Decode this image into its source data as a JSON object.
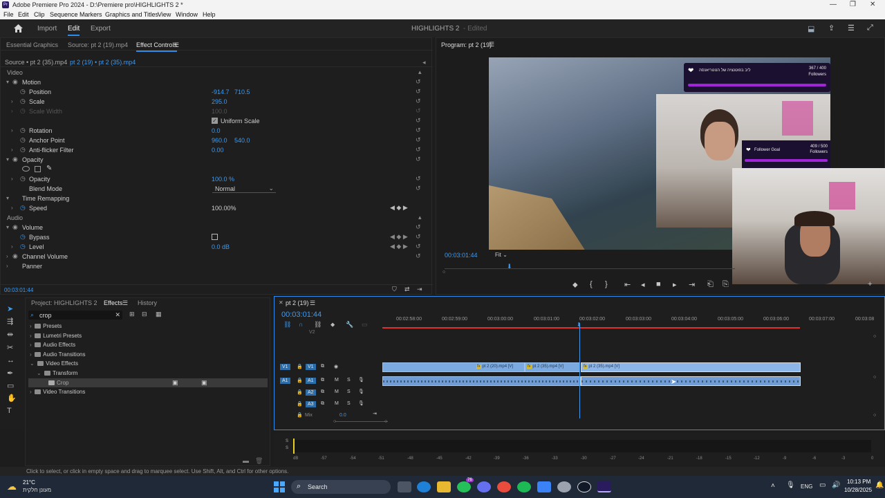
{
  "window": {
    "title": "Adobe Premiere Pro 2024 - D:\\Premiere pro\\HIGHLIGHTS 2 *",
    "logo": "Pr"
  },
  "menu": [
    "File",
    "Edit",
    "Clip",
    "Sequence",
    "Markers",
    "Graphics and Titles",
    "View",
    "Window",
    "Help"
  ],
  "header": {
    "tabs": [
      "Import",
      "Edit",
      "Export"
    ],
    "active_tab": "Edit",
    "project_title": "HIGHLIGHTS 2",
    "edited": "- Edited"
  },
  "source_panel": {
    "tabs": [
      "Essential Graphics",
      "Source: pt 2 (19).mp4",
      "Effect Controls"
    ],
    "active_tab": "Effect Controls",
    "clip_source": "Source • pt 2 (35).mp4",
    "clip_seq": "pt 2 (19) • pt 2 (35).mp4",
    "rows": {
      "video": "Video",
      "motion": "Motion",
      "position": "Position",
      "position_x": "-914.7",
      "position_y": "710.5",
      "scale": "Scale",
      "scale_v": "295.0",
      "scale_width": "Scale Width",
      "scale_width_v": "100.0",
      "uniform_scale": "Uniform Scale",
      "rotation": "Rotation",
      "rotation_v": "0.0",
      "anchor": "Anchor Point",
      "anchor_x": "960.0",
      "anchor_y": "540.0",
      "flicker": "Anti-flicker Filter",
      "flicker_v": "0.00",
      "opacity_sec": "Opacity",
      "opacity": "Opacity",
      "opacity_v": "100.0 %",
      "blend": "Blend Mode",
      "blend_v": "Normal",
      "time_remap": "Time Remapping",
      "speed": "Speed",
      "speed_v": "100.00%",
      "audio": "Audio",
      "volume": "Volume",
      "bypass": "Bypass",
      "level": "Level",
      "level_v": "0.0 dB",
      "channel_volume": "Channel Volume",
      "panner": "Panner"
    },
    "timecode": "00:03:01:44"
  },
  "program": {
    "title": "Program: pt 2 (19)",
    "timecode": "00:03:01:44",
    "fit": "Fit",
    "overlay1": {
      "title": "ליב בפוטנציה של הנוטריאנסה",
      "count": "367 / 400",
      "sub": "Followers"
    },
    "overlay2": {
      "title": "Follower Goal",
      "count": "409 / 500",
      "sub": "Followers"
    }
  },
  "project_panel": {
    "tabs": [
      "Project: HIGHLIGHTS 2",
      "Effects",
      "History"
    ],
    "active_tab": "Effects",
    "search_value": "crop",
    "tree": [
      "Presets",
      "Lumetri Presets",
      "Audio Effects",
      "Audio Transitions",
      "Video Effects",
      "Transform",
      "Crop",
      "Video Transitions"
    ]
  },
  "timeline": {
    "title": "pt 2 (19)",
    "timecode": "00:03:01:44",
    "ticks": [
      "00:02:58:00",
      "00:02:59:00",
      "00:03:00:00",
      "00:03:01:00",
      "00:03:02:00",
      "00:03:03:00",
      "00:03:04:00",
      "00:03:05:00",
      "00:03:06:00",
      "00:03:07:00",
      "00:03:08"
    ],
    "tracks": {
      "v2": "V2",
      "v1": "V1",
      "a1": "A1",
      "a2": "A2",
      "a3": "A3",
      "m": "M",
      "s": "S",
      "mix": "Mix",
      "mix_v": "0.0"
    },
    "clips": [
      "pt 2 (20).mp4 [V]",
      "pt 2 (35).mp4 [V]",
      "pt 2 (35).mp4 [V]"
    ]
  },
  "meter": {
    "labels": [
      "dB",
      "-57",
      "-54",
      "-51",
      "-48",
      "-45",
      "-42",
      "-39",
      "-36",
      "-33",
      "-30",
      "-27",
      "-24",
      "-21",
      "-18",
      "-15",
      "-12",
      "-9",
      "-6",
      "-3",
      "0"
    ],
    "s": "S"
  },
  "status_text": "Click to select, or click in empty space and drag to marquee select. Use Shift, Alt, and Ctrl for other options.",
  "taskbar": {
    "weather_temp": "21°C",
    "weather_desc": "מעונן חלקית",
    "search": "Search",
    "lang": "ENG",
    "time": "10:13 PM",
    "date": "10/28/2025",
    "badge": "76"
  },
  "colors": {
    "accent": "#2d8ceb",
    "clip_video": "#7aaae0",
    "playhead": "#3e9bf0",
    "work_area": "#e03030"
  }
}
